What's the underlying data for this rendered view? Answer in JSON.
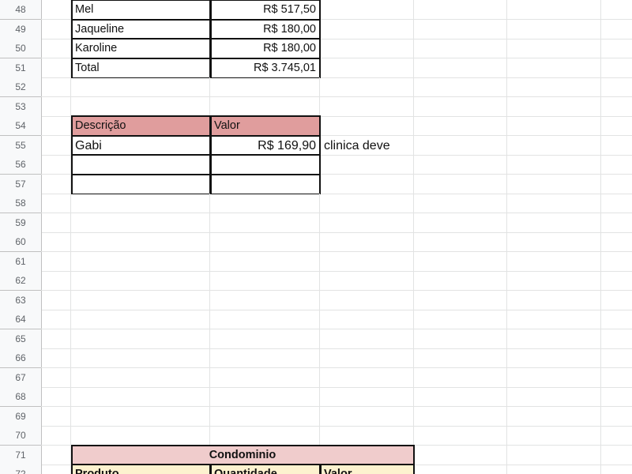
{
  "sheet": {
    "rows": [
      {
        "num": "48",
        "cells": [
          {
            "col": 1,
            "text": "Mel",
            "align": "left",
            "bt": 1,
            "bb": 1,
            "bl": 1,
            "br": 1
          },
          {
            "col": 2,
            "text": "R$ 517,50",
            "align": "right",
            "bt": 1,
            "bb": 1,
            "bl": 1,
            "br": 1
          }
        ]
      },
      {
        "num": "49",
        "cells": [
          {
            "col": 1,
            "text": "Jaqueline",
            "align": "left",
            "bt": 1,
            "bb": 1,
            "bl": 1,
            "br": 1
          },
          {
            "col": 2,
            "text": "R$ 180,00",
            "align": "right",
            "bt": 1,
            "bb": 1,
            "bl": 1,
            "br": 1
          }
        ]
      },
      {
        "num": "50",
        "cells": [
          {
            "col": 1,
            "text": "Karoline",
            "align": "left",
            "bt": 1,
            "bb": 1,
            "bl": 1,
            "br": 1
          },
          {
            "col": 2,
            "text": "R$ 180,00",
            "align": "right",
            "bt": 1,
            "bb": 1,
            "bl": 1,
            "br": 1
          }
        ]
      },
      {
        "num": "51",
        "cells": [
          {
            "col": 1,
            "text": "Total",
            "align": "left",
            "bt": 1,
            "bb": 1,
            "bl": 1,
            "br": 1
          },
          {
            "col": 2,
            "text": "R$ 3.745,01",
            "align": "right",
            "bt": 1,
            "bb": 1,
            "bl": 1,
            "br": 1
          }
        ]
      },
      {
        "num": "52",
        "cells": []
      },
      {
        "num": "53",
        "cells": []
      },
      {
        "num": "54",
        "cells": [
          {
            "col": 1,
            "text": "Descrição",
            "align": "left",
            "bg": "#e09d9d",
            "bt": 1,
            "bb": 1,
            "bl": 1,
            "br": 1
          },
          {
            "col": 2,
            "text": "Valor",
            "align": "left",
            "bg": "#e09d9d",
            "bt": 1,
            "bb": 1,
            "bl": 1,
            "br": 1
          }
        ]
      },
      {
        "num": "55",
        "cells": [
          {
            "col": 1,
            "text": "Gabi",
            "align": "left",
            "big": true,
            "bt": 1,
            "bb": 1,
            "bl": 1,
            "br": 1
          },
          {
            "col": 2,
            "text": "R$ 169,90",
            "align": "right",
            "big": true,
            "bt": 1,
            "bb": 1,
            "bl": 1,
            "br": 1
          },
          {
            "col": 3,
            "text": "clinica deve",
            "align": "left",
            "big": true,
            "overflow": true
          }
        ]
      },
      {
        "num": "56",
        "cells": [
          {
            "col": 1,
            "text": "",
            "bt": 1,
            "bb": 1,
            "bl": 1,
            "br": 1
          },
          {
            "col": 2,
            "text": "",
            "bt": 1,
            "bb": 1,
            "bl": 1,
            "br": 1
          }
        ]
      },
      {
        "num": "57",
        "cells": [
          {
            "col": 1,
            "text": "",
            "bt": 1,
            "bb": 1,
            "bl": 1,
            "br": 1
          },
          {
            "col": 2,
            "text": "",
            "bt": 1,
            "bb": 1,
            "bl": 1,
            "br": 1
          }
        ]
      },
      {
        "num": "58",
        "cells": []
      },
      {
        "num": "59",
        "cells": []
      },
      {
        "num": "60",
        "cells": []
      },
      {
        "num": "61",
        "cells": []
      },
      {
        "num": "62",
        "cells": []
      },
      {
        "num": "63",
        "cells": []
      },
      {
        "num": "64",
        "cells": []
      },
      {
        "num": "65",
        "cells": []
      },
      {
        "num": "66",
        "cells": []
      },
      {
        "num": "67",
        "cells": []
      },
      {
        "num": "68",
        "cells": []
      },
      {
        "num": "69",
        "cells": []
      },
      {
        "num": "70",
        "cells": []
      },
      {
        "num": "71",
        "cells": [
          {
            "col": 1,
            "span": 3,
            "text": "Condominio",
            "align": "center",
            "bg": "#f0cccc",
            "bt": 1,
            "bb": 1,
            "bl": 1,
            "br": 1
          }
        ]
      },
      {
        "num": "72",
        "cells": [
          {
            "col": 1,
            "text": "Produto",
            "align": "left",
            "bold": true,
            "bg": "#fdf2cf",
            "bt": 1,
            "bl": 1,
            "br": 1
          },
          {
            "col": 2,
            "text": "Quantidade",
            "align": "left",
            "bold": true,
            "bg": "#fdf2cf",
            "bt": 1,
            "bl": 1,
            "br": 1
          },
          {
            "col": 3,
            "text": "Valor",
            "align": "left",
            "bold": true,
            "bg": "#fdf2cf",
            "bt": 1,
            "bl": 1,
            "br": 1
          }
        ]
      }
    ]
  }
}
